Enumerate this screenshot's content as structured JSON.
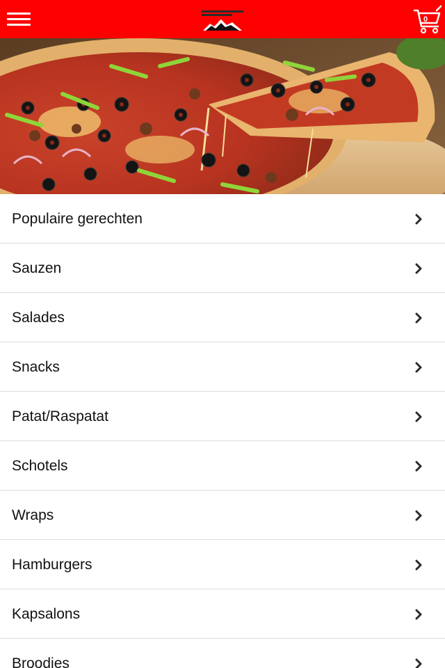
{
  "header": {
    "menu_icon": "hamburger-menu-icon",
    "logo_icon": "restaurant-logo",
    "cart_icon": "shopping-cart-icon",
    "cart_count": "0",
    "background_color": "#ff0000"
  },
  "banner": {
    "image_subject": "pizza-photo"
  },
  "categories": [
    {
      "label": "Populaire gerechten"
    },
    {
      "label": "Sauzen"
    },
    {
      "label": "Salades"
    },
    {
      "label": "Snacks"
    },
    {
      "label": "Patat/Raspatat"
    },
    {
      "label": "Schotels"
    },
    {
      "label": "Wraps"
    },
    {
      "label": "Hamburgers"
    },
    {
      "label": "Kapsalons"
    },
    {
      "label": "Broodjes"
    }
  ],
  "chevron_icon": "chevron-right-icon"
}
